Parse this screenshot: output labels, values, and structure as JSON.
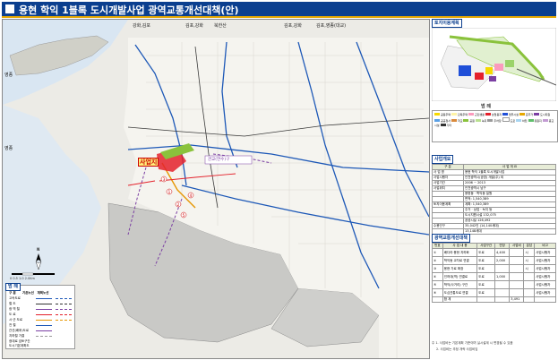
{
  "title": {
    "text": "용현 학익 1블록 도시개발사업 광역교통개선대책(안)"
  },
  "map": {
    "site_label": "사업지",
    "top_labels": [
      "강화,김포",
      "김포,강화",
      "북한산",
      "김포,강화",
      "김포,영종(대교)"
    ],
    "left_labels": [
      "영종",
      "영종"
    ],
    "district_label": "관교(연수)구",
    "scale_label": "0    0.5    1.0    2.0Km",
    "compass": "N",
    "colors": {
      "site": "#e4212b",
      "road_main": "#1d58b7",
      "rail": "#7b3fa3",
      "new_road": "#e69500",
      "highlight": "#fff07a"
    }
  },
  "legend": {
    "title": "범 례",
    "header": [
      "구 분",
      "기존노선",
      "계획노선"
    ],
    "rows": [
      "고속도로",
      "철 도",
      "광 역 철",
      "도 로",
      "시·군 도로",
      "전 철",
      "간선(배후)도로",
      "지하철 가결"
    ],
    "extra_row": "광대로 검토구간",
    "plan_label": "도시기본계획도"
  },
  "panel": {
    "plan_box_title": "토지이용계획",
    "land_use": {
      "title": "범 례",
      "items": [
        "공동주택",
        "단독주택",
        "근린생활",
        "상업용지",
        "업무시설",
        "준주거",
        "도시지원",
        "공공청사",
        "학교",
        "공원",
        "녹지",
        "주차장",
        "도로",
        "하천",
        "유원지",
        "종교시설",
        "기타"
      ]
    },
    "overview": {
      "title": "사업개요",
      "header": [
        "구 분",
        "사 업 개 요"
      ],
      "rows": [
        [
          "사 업 명",
          "용현 학익 1블록 도시개발사업"
        ],
        [
          "사업시행자",
          "인천광역시(공영) 개발(주) 외"
        ],
        [
          "사업기간",
          "2006 ~ 2013"
        ],
        [
          "사업위치",
          "인천광역시 남구"
        ],
        [
          "",
          "용현동 · 학익동 일원"
        ],
        [
          "",
          "면적: 1,540,389"
        ],
        [
          "토지이용계획",
          "계획: 1,540,389"
        ],
        [
          "",
          "주거 · 상업 · 녹지 등"
        ],
        [
          "",
          "도시지원시설 132,075"
        ],
        [
          "",
          "공공시설 126,492"
        ],
        [
          "수용인구",
          "35,042인 (14,140세대)"
        ],
        [
          "",
          "13,148세대"
        ]
      ]
    },
    "traffic": {
      "title": "광역교통개선대책",
      "header": [
        "번호",
        "사 업 내 용",
        "사업구간",
        "연장",
        "사업비",
        "분담",
        "비고"
      ],
      "rows": [
        [
          "①",
          "배다리·용현 지하화",
          "도로",
          "4,400",
          "",
          "시",
          "사업시행자"
        ],
        [
          "②",
          "학익동 교차로 연결",
          "도로",
          "2,000",
          "",
          "시",
          "사업시행자"
        ],
        [
          "③",
          "용현 가로 확장",
          "도로",
          "",
          "",
          "시",
          "사업시행자"
        ],
        [
          "④",
          "인하대(역) 연결로",
          "도로",
          "1,000",
          "",
          "",
          "사업시행자"
        ],
        [
          "⑤",
          "학익(사거리) 구간",
          "도로",
          "",
          "",
          "",
          "사업시행자"
        ],
        [
          "⑥",
          "도심관통도로 연결",
          "도로",
          "",
          "",
          "",
          "사업시행자"
        ],
        [
          "",
          "합 계",
          "",
          "",
          "3,491",
          "",
          ""
        ]
      ]
    },
    "footnotes": [
      "주 1. 사업비는 기본계획 기준이며 실시설계 시 변경될 수 있음",
      "2. 사업비는 추정 개략 사업비임"
    ]
  }
}
